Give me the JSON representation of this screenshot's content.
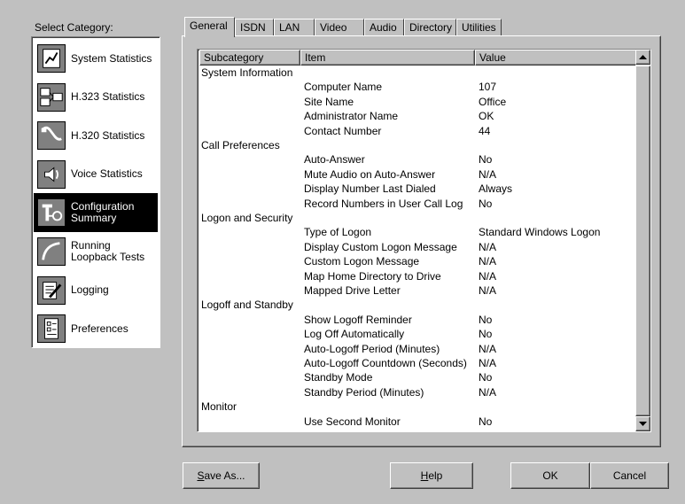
{
  "sidebar": {
    "label": "Select Category:",
    "items": [
      {
        "label": "System Statistics",
        "icon": "system-statistics-icon"
      },
      {
        "label": "H.323 Statistics",
        "icon": "network-computers-icon"
      },
      {
        "label": "H.320 Statistics",
        "icon": "phone-cable-icon"
      },
      {
        "label": "Voice Statistics",
        "icon": "speaker-icon"
      },
      {
        "label": "Configuration Summary",
        "icon": "configuration-tools-icon",
        "selected": true
      },
      {
        "label": "Running Loopback Tests",
        "icon": "loopback-icon"
      },
      {
        "label": "Logging",
        "icon": "notepad-pencil-icon"
      },
      {
        "label": "Preferences",
        "icon": "checklist-icon"
      }
    ]
  },
  "tabs": [
    "General",
    "ISDN",
    "LAN",
    "Video",
    "Audio",
    "Directory",
    "Utilities"
  ],
  "active_tab": "General",
  "table": {
    "headers": [
      "Subcategory",
      "Item",
      "Value"
    ],
    "rows": [
      {
        "subcategory": "System Information",
        "item": "",
        "value": ""
      },
      {
        "subcategory": "",
        "item": "Computer Name",
        "value": "107"
      },
      {
        "subcategory": "",
        "item": "Site Name",
        "value": "Office"
      },
      {
        "subcategory": "",
        "item": "Administrator Name",
        "value": "OK"
      },
      {
        "subcategory": "",
        "item": "Contact Number",
        "value": "44"
      },
      {
        "subcategory": "Call Preferences",
        "item": "",
        "value": ""
      },
      {
        "subcategory": "",
        "item": "Auto-Answer",
        "value": "No"
      },
      {
        "subcategory": "",
        "item": "Mute Audio on Auto-Answer",
        "value": "N/A"
      },
      {
        "subcategory": "",
        "item": "Display Number Last Dialed",
        "value": "Always"
      },
      {
        "subcategory": "",
        "item": "Record Numbers in User Call Log",
        "value": "No"
      },
      {
        "subcategory": "Logon and Security",
        "item": "",
        "value": ""
      },
      {
        "subcategory": "",
        "item": "Type of Logon",
        "value": "Standard Windows Logon"
      },
      {
        "subcategory": "",
        "item": "Display Custom Logon Message",
        "value": "N/A"
      },
      {
        "subcategory": "",
        "item": "Custom Logon Message",
        "value": "N/A"
      },
      {
        "subcategory": "",
        "item": "Map Home Directory to Drive",
        "value": "N/A"
      },
      {
        "subcategory": "",
        "item": "Mapped Drive Letter",
        "value": "N/A"
      },
      {
        "subcategory": "Logoff and Standby",
        "item": "",
        "value": ""
      },
      {
        "subcategory": "",
        "item": "Show Logoff Reminder",
        "value": "No"
      },
      {
        "subcategory": "",
        "item": "Log Off Automatically",
        "value": "No"
      },
      {
        "subcategory": "",
        "item": "Auto-Logoff Period (Minutes)",
        "value": "N/A"
      },
      {
        "subcategory": "",
        "item": "Auto-Logoff Countdown (Seconds)",
        "value": "N/A"
      },
      {
        "subcategory": "",
        "item": "Standby Mode",
        "value": "No"
      },
      {
        "subcategory": "",
        "item": "Standby Period (Minutes)",
        "value": "N/A"
      },
      {
        "subcategory": "Monitor",
        "item": "",
        "value": ""
      },
      {
        "subcategory": "",
        "item": "Use Second Monitor",
        "value": "No"
      }
    ]
  },
  "buttons": {
    "save_as": "Save As...",
    "help": "Help",
    "ok": "OK",
    "cancel": "Cancel"
  }
}
